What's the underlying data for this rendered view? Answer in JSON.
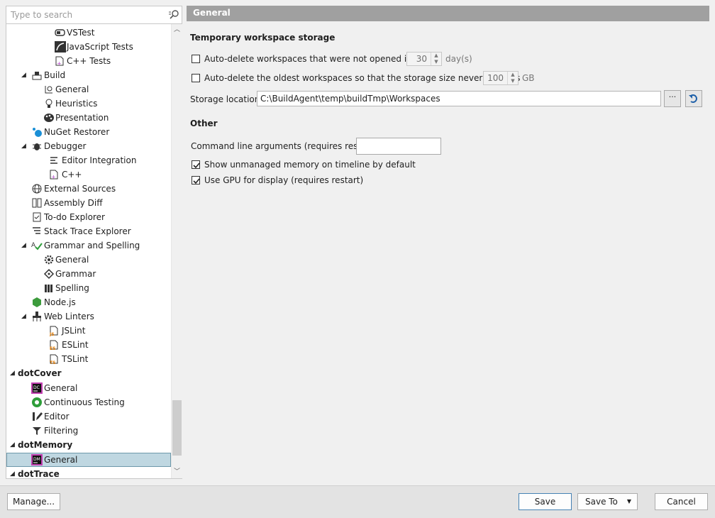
{
  "search": {
    "placeholder": "Type to search"
  },
  "tree": {
    "vstest": "VSTest",
    "javascript_tests": "JavaScript Tests",
    "cpp_tests": "C++ Tests",
    "build": "Build",
    "build_general": "General",
    "build_heuristics": "Heuristics",
    "build_presentation": "Presentation",
    "nuget_restorer": "NuGet Restorer",
    "debugger": "Debugger",
    "editor_integration": "Editor Integration",
    "debugger_cpp": "C++",
    "external_sources": "External Sources",
    "assembly_diff": "Assembly Diff",
    "todo_explorer": "To-do Explorer",
    "stack_trace_explorer": "Stack Trace Explorer",
    "grammar_and_spelling": "Grammar and Spelling",
    "gs_general": "General",
    "gs_grammar": "Grammar",
    "gs_spelling": "Spelling",
    "nodejs": "Node.js",
    "web_linters": "Web Linters",
    "jslint": "JSLint",
    "eslint": "ESLint",
    "tslint": "TSLint",
    "dotcover": "dotCover",
    "dc_general": "General",
    "continuous_testing": "Continuous Testing",
    "editor": "Editor",
    "filtering": "Filtering",
    "dotmemory": "dotMemory",
    "dm_general": "General",
    "dottrace": "dotTrace"
  },
  "panel": {
    "title": "General",
    "temp_section": "Temporary workspace storage",
    "auto_delete_days_label": "Auto-delete workspaces that were not opened in last",
    "auto_delete_days_value": "30",
    "auto_delete_days_unit": "day(s)",
    "auto_delete_size_label": "Auto-delete the oldest workspaces so that the storage size never exceeds",
    "auto_delete_size_value": "100",
    "auto_delete_size_unit": "GB",
    "storage_location_label": "Storage location:",
    "storage_location_value": "C:\\BuildAgent\\temp\\buildTmp\\Workspaces",
    "browse_label": "···",
    "other_section": "Other",
    "cmd_args_label": "Command line arguments (requires restart)",
    "cmd_args_value": "",
    "show_unmanaged_label": "Show unmanaged memory on timeline by default",
    "use_gpu_label": "Use GPU for display (requires restart)"
  },
  "footer": {
    "manage": "Manage...",
    "save": "Save",
    "save_to": "Save To",
    "cancel": "Cancel"
  },
  "colors": {
    "accent": "#4682b4",
    "selection": "#bfd7e1",
    "header": "#a0a0a0"
  }
}
